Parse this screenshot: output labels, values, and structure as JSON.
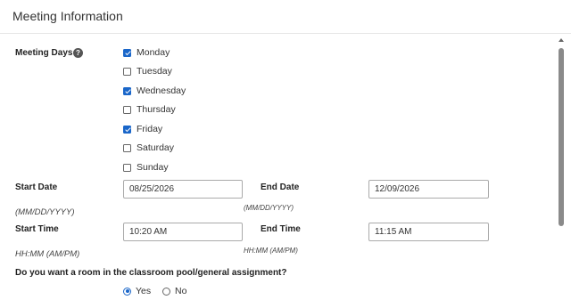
{
  "header": {
    "title": "Meeting Information"
  },
  "meeting_days": {
    "label": "Meeting Days",
    "help_icon": "question-circle-icon",
    "help_glyph": "?",
    "days": [
      {
        "label": "Monday",
        "checked": true
      },
      {
        "label": "Tuesday",
        "checked": false
      },
      {
        "label": "Wednesday",
        "checked": true
      },
      {
        "label": "Thursday",
        "checked": false
      },
      {
        "label": "Friday",
        "checked": true
      },
      {
        "label": "Saturday",
        "checked": false
      },
      {
        "label": "Sunday",
        "checked": false
      }
    ]
  },
  "start_date": {
    "label": "Start Date",
    "value": "08/25/2026",
    "hint": "(MM/DD/YYYY)"
  },
  "end_date": {
    "label": "End Date",
    "value": "12/09/2026",
    "hint": "(MM/DD/YYYY)"
  },
  "start_time": {
    "label": "Start Time",
    "value": "10:20 AM",
    "hint": "HH:MM (AM/PM)"
  },
  "end_time": {
    "label": "End Time",
    "value": "11:15 AM",
    "hint": "HH:MM (AM/PM)"
  },
  "room_pool": {
    "question": "Do you want a room in the classroom pool/general assignment?",
    "options": [
      {
        "label": "Yes",
        "selected": true
      },
      {
        "label": "No",
        "selected": false
      }
    ]
  },
  "colors": {
    "accent": "#1a66c9"
  }
}
